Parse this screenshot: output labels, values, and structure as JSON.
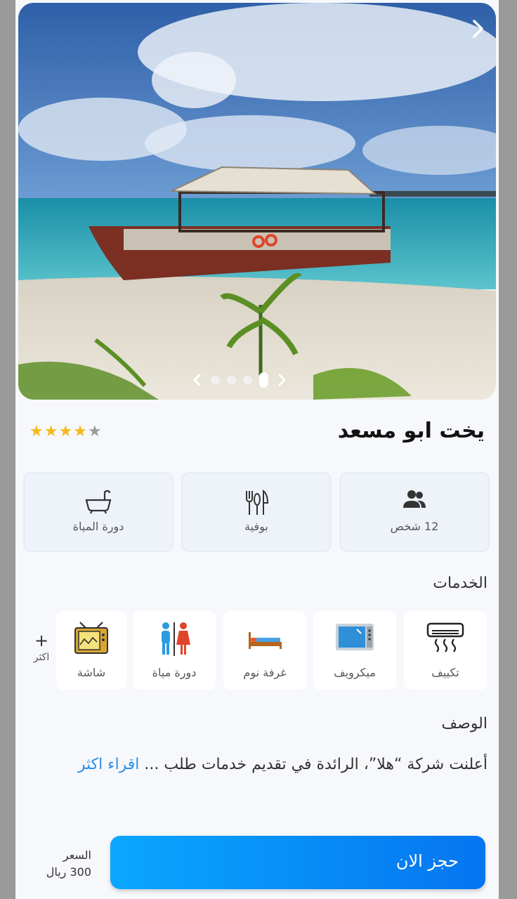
{
  "listing": {
    "title": "يخت ابو مسعد",
    "rating": 4,
    "rating_max": 5
  },
  "carousel": {
    "slide_count": 4,
    "active_index": 3
  },
  "features": [
    {
      "label": "12 شخص",
      "icon": "people-icon"
    },
    {
      "label": "بوفية",
      "icon": "cutlery-icon"
    },
    {
      "label": "دورة المياة",
      "icon": "bathtub-icon"
    }
  ],
  "services": {
    "title": "الخدمات",
    "items": [
      {
        "label": "تكييف",
        "icon": "air-conditioner-icon"
      },
      {
        "label": "ميكرويف",
        "icon": "microwave-icon"
      },
      {
        "label": "غرفة نوم",
        "icon": "bed-icon"
      },
      {
        "label": "دورة مياة",
        "icon": "restroom-icon"
      },
      {
        "label": "شاشة",
        "icon": "tv-icon"
      }
    ],
    "more_symbol": "+",
    "more_label": "اكثر"
  },
  "description": {
    "title": "الوصف",
    "text": "أعلنت شركة “هلا”، الرائدة في تقديم خدمات طلب ... ",
    "read_more": "اقراء اكثر"
  },
  "footer": {
    "book_label": "حجز الان",
    "price_label": "السعر",
    "price_value": "300 ريال"
  },
  "colors": {
    "accent": "#0a8cf5",
    "star": "#f6b81a",
    "link": "#2f8fe0"
  }
}
